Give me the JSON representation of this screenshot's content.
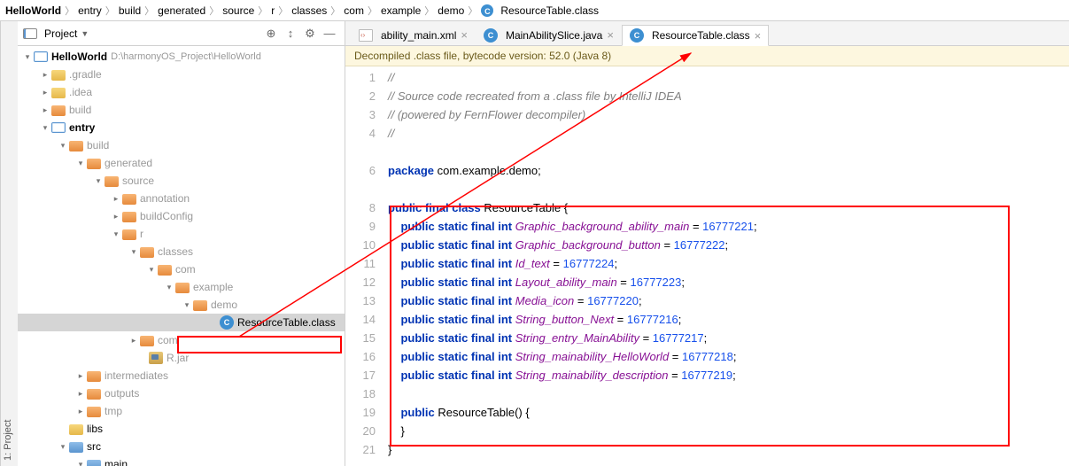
{
  "breadcrumbs": [
    "HelloWorld",
    "entry",
    "build",
    "generated",
    "source",
    "r",
    "classes",
    "com",
    "example",
    "demo"
  ],
  "breadcrumb_file": "ResourceTable.class",
  "side_tab": "1: Project",
  "project_panel": {
    "title": "Project"
  },
  "tree": {
    "root_name": "HelloWorld",
    "root_path": "D:\\harmonyOS_Project\\HelloWorld",
    "n_gradle": ".gradle",
    "n_idea": ".idea",
    "n_build_top": "build",
    "n_entry": "entry",
    "n_build": "build",
    "n_generated": "generated",
    "n_source": "source",
    "n_annotation": "annotation",
    "n_buildconfig": "buildConfig",
    "n_r": "r",
    "n_classes": "classes",
    "n_com": "com",
    "n_example": "example",
    "n_demo": "demo",
    "n_resourcetable": "ResourceTable.class",
    "n_com2": "com",
    "n_rjar": "R.jar",
    "n_intermediates": "intermediates",
    "n_outputs": "outputs",
    "n_tmp": "tmp",
    "n_libs": "libs",
    "n_src": "src",
    "n_main": "main"
  },
  "tabs": [
    {
      "label": "ability_main.xml",
      "icon": "xml"
    },
    {
      "label": "MainAbilitySlice.java",
      "icon": "class"
    },
    {
      "label": "ResourceTable.class",
      "icon": "class",
      "active": true
    }
  ],
  "banner": "Decompiled .class file, bytecode version: 52.0 (Java 8)",
  "code": {
    "lines": [
      "1",
      "2",
      "3",
      "4",
      "",
      "6",
      "",
      "8",
      "9",
      "10",
      "11",
      "12",
      "13",
      "14",
      "15",
      "16",
      "17",
      "18",
      "19",
      "20",
      "21"
    ],
    "c1": "//",
    "c2": "// Source code recreated from a .class file by IntelliJ IDEA",
    "c3": "// (powered by FernFlower decompiler)",
    "c4": "//",
    "pkg_kw": "package",
    "pkg": "com.example.demo",
    "cls_mods": "public final class",
    "cls_name": "ResourceTable",
    "field_mods": "public static final int",
    "f1": "Graphic_background_ability_main",
    "v1": "16777221",
    "f2": "Graphic_background_button",
    "v2": "16777222",
    "f3": "Id_text",
    "v3": "16777224",
    "f4": "Layout_ability_main",
    "v4": "16777223",
    "f5": "Media_icon",
    "v5": "16777220",
    "f6": "String_button_Next",
    "v6": "16777216",
    "f7": "String_entry_MainAbility",
    "v7": "16777217",
    "f8": "String_mainability_HelloWorld",
    "v8": "16777218",
    "f9": "String_mainability_description",
    "v9": "16777219",
    "ctor_mod": "public",
    "ctor_name": "ResourceTable"
  }
}
